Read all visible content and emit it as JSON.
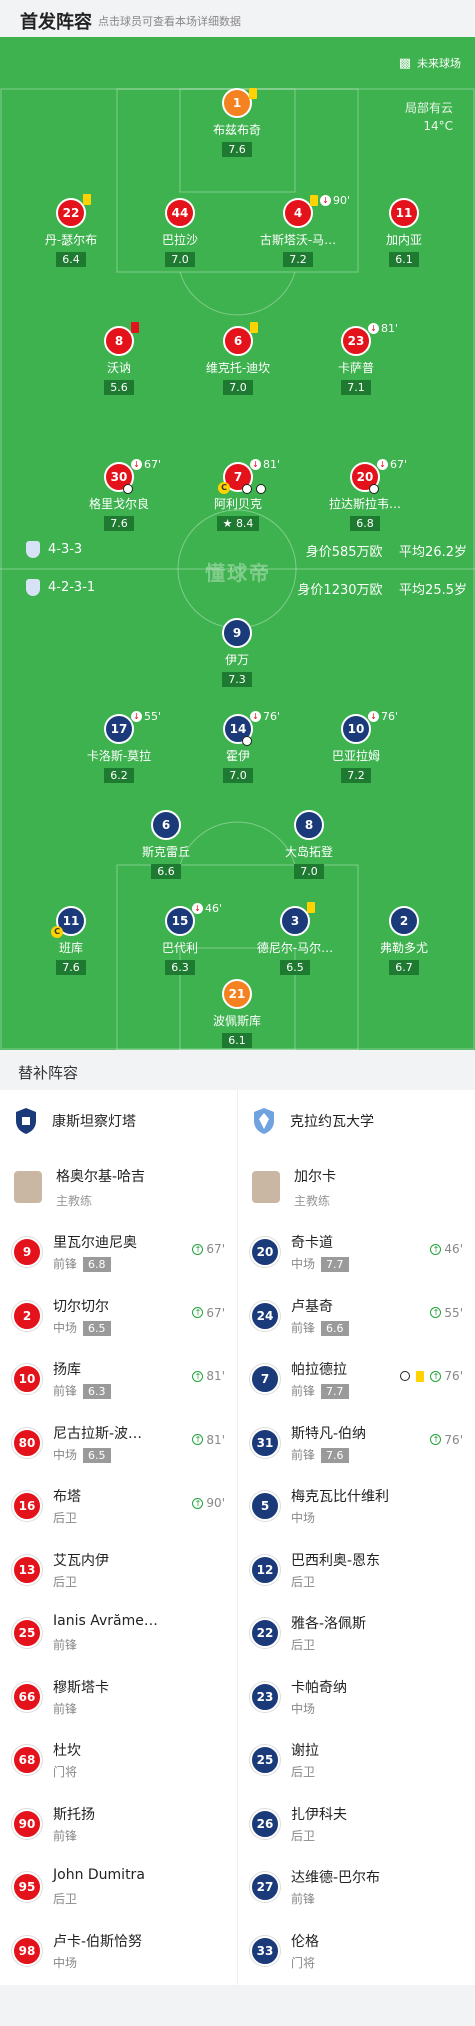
{
  "header": {
    "title": "首发阵容",
    "subtitle": "点击球员可查看本场详细数据"
  },
  "pitch": {
    "stadium": "未来球场",
    "weather": "局部有云",
    "temperature": "14°C",
    "watermark": "懂球帝",
    "home_formation": "4-3-3",
    "home_value": "身价585万欧",
    "home_age": "平均26.2岁",
    "away_formation": "4-2-3-1",
    "away_value": "身价1230万欧",
    "away_age": "平均25.5岁",
    "home_players": [
      {
        "num": "1",
        "name": "布兹布奇",
        "rating": "7.6"
      },
      {
        "num": "22",
        "name": "丹-瑟尔布",
        "rating": "6.4"
      },
      {
        "num": "44",
        "name": "巴拉沙",
        "rating": "7.0"
      },
      {
        "num": "4",
        "name": "古斯塔沃-马…",
        "rating": "7.2",
        "event": "90'"
      },
      {
        "num": "11",
        "name": "加内亚",
        "rating": "6.1"
      },
      {
        "num": "8",
        "name": "沃讷",
        "rating": "5.6"
      },
      {
        "num": "6",
        "name": "维克托-迪坎",
        "rating": "7.0"
      },
      {
        "num": "23",
        "name": "卡萨普",
        "rating": "7.1",
        "event": "81'"
      },
      {
        "num": "30",
        "name": "格里戈尔良",
        "rating": "7.6",
        "event": "67'"
      },
      {
        "num": "7",
        "name": "阿利贝克",
        "rating": "8.4",
        "event": "81'"
      },
      {
        "num": "20",
        "name": "拉达斯拉韦…",
        "rating": "6.8",
        "event": "67'"
      }
    ],
    "away_players": [
      {
        "num": "9",
        "name": "伊万",
        "rating": "7.3"
      },
      {
        "num": "17",
        "name": "卡洛斯-莫拉",
        "rating": "6.2",
        "event": "55'"
      },
      {
        "num": "14",
        "name": "霍伊",
        "rating": "7.0",
        "event": "76'"
      },
      {
        "num": "10",
        "name": "巴亚拉姆",
        "rating": "7.2",
        "event": "76'"
      },
      {
        "num": "6",
        "name": "斯克雷丘",
        "rating": "6.6"
      },
      {
        "num": "8",
        "name": "大岛拓登",
        "rating": "7.0"
      },
      {
        "num": "11",
        "name": "班库",
        "rating": "7.6"
      },
      {
        "num": "15",
        "name": "巴代利",
        "rating": "6.3",
        "event": "46'"
      },
      {
        "num": "3",
        "name": "德尼尔-马尔…",
        "rating": "6.5"
      },
      {
        "num": "2",
        "name": "弗勒多尤",
        "rating": "6.7"
      },
      {
        "num": "21",
        "name": "波佩斯库",
        "rating": "6.1"
      }
    ]
  },
  "subs": {
    "title": "替补阵容",
    "home": {
      "team": "康斯坦察灯塔",
      "coach": "格奥尔基-哈吉",
      "coach_role": "主教练",
      "players": [
        {
          "num": "9",
          "name": "里瓦尔迪尼奥",
          "pos": "前锋",
          "rating": "6.8",
          "in": "67'"
        },
        {
          "num": "2",
          "name": "切尔切尔",
          "pos": "中场",
          "rating": "6.5",
          "in": "67'"
        },
        {
          "num": "10",
          "name": "扬库",
          "pos": "前锋",
          "rating": "6.3",
          "in": "81'"
        },
        {
          "num": "80",
          "name": "尼古拉斯-波…",
          "pos": "中场",
          "rating": "6.5",
          "in": "81'"
        },
        {
          "num": "16",
          "name": "布塔",
          "pos": "后卫",
          "rating": "",
          "in": "90'"
        },
        {
          "num": "13",
          "name": "艾瓦内伊",
          "pos": "后卫",
          "rating": "",
          "in": ""
        },
        {
          "num": "25",
          "name": "Ianis Avrăme…",
          "pos": "前锋",
          "rating": "",
          "in": ""
        },
        {
          "num": "66",
          "name": "穆斯塔卡",
          "pos": "前锋",
          "rating": "",
          "in": ""
        },
        {
          "num": "68",
          "name": "杜坎",
          "pos": "门将",
          "rating": "",
          "in": ""
        },
        {
          "num": "90",
          "name": "斯托扬",
          "pos": "前锋",
          "rating": "",
          "in": ""
        },
        {
          "num": "95",
          "name": "John Dumitra",
          "pos": "后卫",
          "rating": "",
          "in": ""
        },
        {
          "num": "98",
          "name": "卢卡-伯斯恰努",
          "pos": "中场",
          "rating": "",
          "in": ""
        }
      ]
    },
    "away": {
      "team": "克拉约瓦大学",
      "coach": "加尔卡",
      "coach_role": "主教练",
      "players": [
        {
          "num": "20",
          "name": "奇卡道",
          "pos": "中场",
          "rating": "7.7",
          "in": "46'"
        },
        {
          "num": "24",
          "name": "卢基奇",
          "pos": "前锋",
          "rating": "6.6",
          "in": "55'"
        },
        {
          "num": "7",
          "name": "帕拉德拉",
          "pos": "前锋",
          "rating": "7.7",
          "in": "76'"
        },
        {
          "num": "31",
          "name": "斯特凡-伯纳",
          "pos": "前锋",
          "rating": "7.6",
          "in": "76'"
        },
        {
          "num": "5",
          "name": "梅克瓦比什维利",
          "pos": "中场",
          "rating": "",
          "in": ""
        },
        {
          "num": "12",
          "name": "巴西利奥-恩东",
          "pos": "后卫",
          "rating": "",
          "in": ""
        },
        {
          "num": "22",
          "name": "雅各-洛佩斯",
          "pos": "后卫",
          "rating": "",
          "in": ""
        },
        {
          "num": "23",
          "name": "卡帕奇纳",
          "pos": "中场",
          "rating": "",
          "in": ""
        },
        {
          "num": "25",
          "name": "谢拉",
          "pos": "后卫",
          "rating": "",
          "in": ""
        },
        {
          "num": "26",
          "name": "扎伊科夫",
          "pos": "后卫",
          "rating": "",
          "in": ""
        },
        {
          "num": "27",
          "name": "达维德-巴尔布",
          "pos": "前锋",
          "rating": "",
          "in": ""
        },
        {
          "num": "33",
          "name": "伦格",
          "pos": "门将",
          "rating": "",
          "in": ""
        }
      ]
    }
  },
  "colors": {
    "pitch": "#3db24e",
    "home": "#e4121b",
    "away": "#1b3a7a",
    "keeper": "#f58220"
  }
}
